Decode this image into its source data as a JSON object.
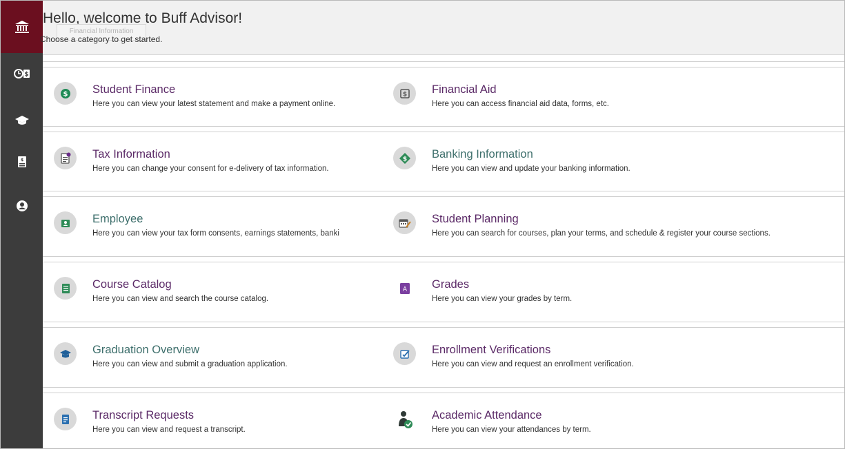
{
  "header": {
    "welcome": "Hello, welcome to Buff Advisor!",
    "subtitle": "Choose a category to get started.",
    "tooltip": "Financial Information"
  },
  "sidebar": {
    "items": [
      {
        "name": "bank-icon",
        "active": true
      },
      {
        "name": "time-money-icon",
        "active": false
      },
      {
        "name": "graduation-cap-icon",
        "active": false
      },
      {
        "name": "document-money-icon",
        "active": false
      },
      {
        "name": "user-circle-icon",
        "active": false
      }
    ]
  },
  "tiles": [
    {
      "title": "Student Finance",
      "desc": "Here you can view your latest statement and make a payment online.",
      "icon": "money-icon"
    },
    {
      "title": "Financial Aid",
      "desc": "Here you can access financial aid data, forms, etc.",
      "icon": "aid-icon"
    },
    {
      "title": "Tax Information",
      "desc": "Here you can change your consent for e-delivery of tax information.",
      "icon": "tax-form-icon"
    },
    {
      "title": "Banking Information",
      "desc": "Here you can view and update your banking information.",
      "icon": "banking-icon"
    },
    {
      "title": "Employee",
      "desc": "Here you can view your tax form consents, earnings statements, banki",
      "icon": "employee-badge-icon"
    },
    {
      "title": "Student Planning",
      "desc": "Here you can search for courses, plan your terms, and schedule & register your course sections.",
      "icon": "planning-calendar-icon"
    },
    {
      "title": "Course Catalog",
      "desc": "Here you can view and search the course catalog.",
      "icon": "catalog-book-icon"
    },
    {
      "title": "Grades",
      "desc": "Here you can view your grades by term.",
      "icon": "grades-icon"
    },
    {
      "title": "Graduation Overview",
      "desc": "Here you can view and submit a graduation application.",
      "icon": "graduation-icon"
    },
    {
      "title": "Enrollment Verifications",
      "desc": "Here you can view and request an enrollment verification.",
      "icon": "verification-icon"
    },
    {
      "title": "Transcript Requests",
      "desc": "Here you can view and request a transcript.",
      "icon": "transcript-icon"
    },
    {
      "title": "Academic Attendance",
      "desc": "Here you can view your attendances by term.",
      "icon": "attendance-icon"
    }
  ],
  "colors": {
    "sidebar": "#3c3c3c",
    "active": "#6b0f1f",
    "title_purple": "#5b2a67",
    "title_teal": "#3e6f6c"
  }
}
